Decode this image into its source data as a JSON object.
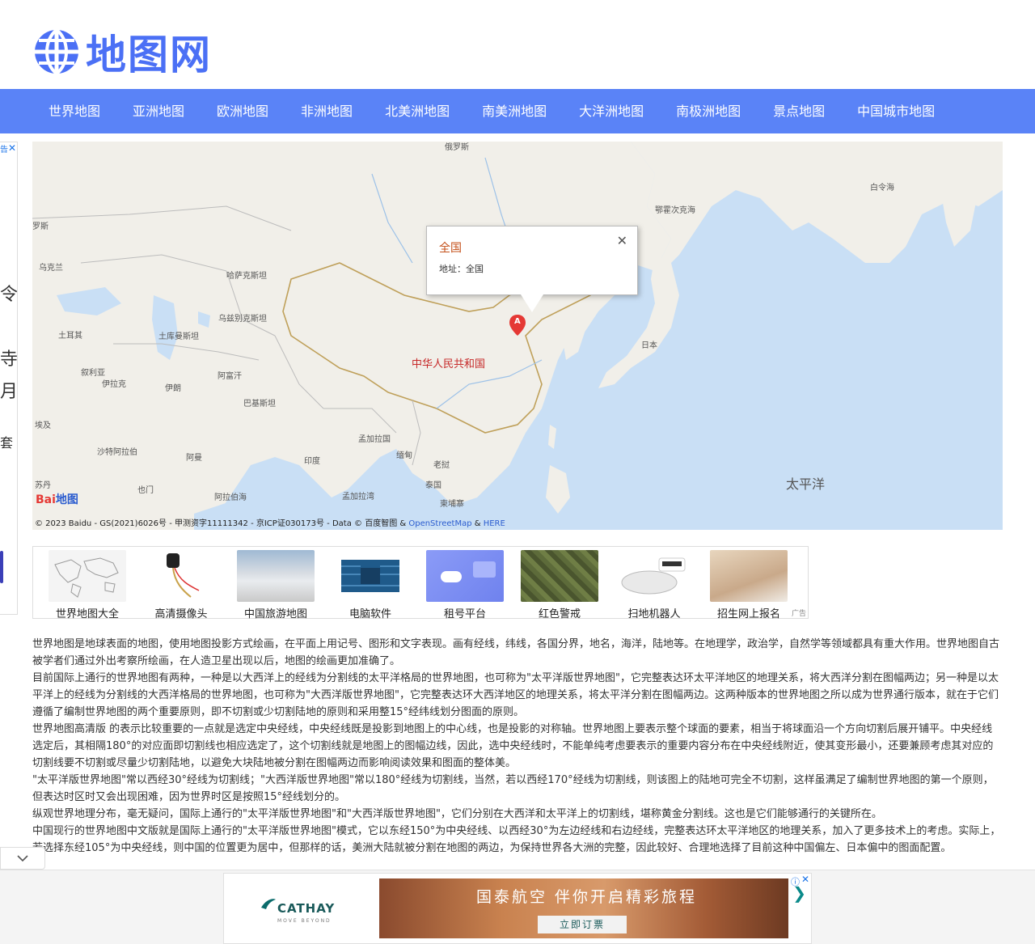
{
  "site": {
    "logo_text": "地图网"
  },
  "nav": [
    {
      "label": "世界地图"
    },
    {
      "label": "亚洲地图"
    },
    {
      "label": "欧洲地图"
    },
    {
      "label": "非洲地图"
    },
    {
      "label": "北美洲地图"
    },
    {
      "label": "南美洲地图"
    },
    {
      "label": "大洋洲地图"
    },
    {
      "label": "南极洲地图"
    },
    {
      "label": "景点地图"
    },
    {
      "label": "中国城市地图"
    }
  ],
  "left_ad": {
    "tag": "告",
    "close": "✕",
    "glyphs": [
      "令",
      "寺",
      "月",
      "套"
    ]
  },
  "map": {
    "labels": [
      "俄罗斯",
      "白令海",
      "鄂霍次克海",
      "罗斯",
      "乌克兰",
      "哈萨克斯坦",
      "乌兹别克斯坦",
      "土耳其",
      "土库曼斯坦",
      "叙利亚",
      "伊拉克",
      "阿富汗",
      "伊朗",
      "巴基斯坦",
      "埃及",
      "沙特阿拉伯",
      "阿曼",
      "印度",
      "孟加拉国",
      "缅甸",
      "老挝",
      "泰国",
      "柬埔寨",
      "苏丹",
      "也门",
      "阿拉伯海",
      "孟加拉湾",
      "日本",
      "太平洋",
      "中华人民共和国"
    ],
    "popup": {
      "title": "全国",
      "address": "地址：全国",
      "close": "✕"
    },
    "marker_letter": "A",
    "baidu_logo": "Bai",
    "baidu_logo_tail": "地图",
    "copyright": "© 2023 Baidu - GS(2021)6026号 - 甲测资字11111342 - 京ICP证030173号 - Data © 百度智图 & ",
    "copyright_link1": "OpenStreetMap",
    "copyright_and": " & ",
    "copyright_link2": "HERE"
  },
  "strip": {
    "items": [
      {
        "caption": "世界地图大全",
        "color": "#f2f2f2"
      },
      {
        "caption": "高清摄像头",
        "color": "#f6efe2"
      },
      {
        "caption": "中国旅游地图",
        "color": "#b8c7d6"
      },
      {
        "caption": "电脑软件",
        "color": "#1f5a8a"
      },
      {
        "caption": "租号平台",
        "color": "#7b8df2"
      },
      {
        "caption": "红色警戒",
        "color": "#5d6b3a"
      },
      {
        "caption": "扫地机器人",
        "color": "#e6e6e6"
      },
      {
        "caption": "招生网上报名",
        "color": "#d8c3a8"
      }
    ],
    "ad_mark": "广告"
  },
  "article": {
    "paragraphs": [
      "世界地图是地球表面的地图，使用地图投影方式绘画，在平面上用记号、图形和文字表现。画有经线，纬线，各国分界，地名，海洋，陆地等。在地理学，政治学，自然学等领域都具有重大作用。世界地图自古被学者们通过外出考察所绘画，在人造卫星出现以后，地图的绘画更加准确了。",
      "目前国际上通行的世界地图有两种，一种是以大西洋上的经线为分割线的太平洋格局的世界地图，也可称为\"太平洋版世界地图\"，它完整表达环太平洋地区的地理关系，将大西洋分割在图幅两边；另一种是以太平洋上的经线为分割线的大西洋格局的世界地图，也可称为\"大西洋版世界地图\"，它完整表达环大西洋地区的地理关系，将太平洋分割在图幅两边。这两种版本的世界地图之所以成为世界通行版本，就在于它们遵循了编制世界地图的两个重要原则，即不切割或少切割陆地的原则和采用整15°经纬线划分图面的原则。",
      "世界地图高清版 的表示比较重要的一点就是选定中央经线，中央经线既是投影到地图上的中心线，也是投影的对称轴。世界地图上要表示整个球面的要素，相当于将球面沿一个方向切割后展开铺平。中央经线选定后，其相隔180°的对应面即切割线也相应选定了，这个切割线就是地图上的图幅边线，因此，选中央经线时，不能单纯考虑要表示的重要内容分布在中央经线附近，使其变形最小，还要兼顾考虑其对应的切割线要不切割或尽量少切割陆地，以避免大块陆地被分割在图幅两边而影响阅读效果和图面的整体美。",
      "\"太平洋版世界地图\"常以西经30°经线为切割线；\"大西洋版世界地图\"常以180°经线为切割线，当然，若以西经170°经线为切割线，则该图上的陆地可完全不切割，这样虽满足了编制世界地图的第一个原则，但表达时区时又会出现困难，因为世界时区是按照15°经线划分的。",
      "纵观世界地理分布，毫无疑问，国际上通行的\"太平洋版世界地图\"和\"大西洋版世界地图\"，它们分别在大西洋和太平洋上的切割线，堪称黄金分割线。这也是它们能够通行的关键所在。",
      "中国现行的世界地图中文版就是国际上通行的\"太平洋版世界地图\"模式，它以东经150°为中央经线、以西经30°为左边经线和右边经线，完整表达环太平洋地区的地理关系，加入了更多技术上的考虑。实际上，若选择东经105°为中央经线，则中国的位置更为居中，但那样的话，美洲大陆就被分割在地图的两边，为保持世界各大洲的完整，因此较好、合理地选择了目前这种中国偏左、日本偏中的图面配置。"
    ]
  },
  "collapse_icon": "chevron-down-icon",
  "bottom_ad": {
    "brand": "CATHAY",
    "brand_sub": "MOVE BEYOND",
    "headline": "国泰航空 伴你开启精彩旅程",
    "button": "立即订票",
    "info": "ⓘ",
    "close": "✕",
    "arrow": "❯"
  },
  "colors": {
    "accent": "#5a83f7",
    "logo": "#4b70f5",
    "sea": "#c9dff5",
    "land": "#f1efe9"
  }
}
